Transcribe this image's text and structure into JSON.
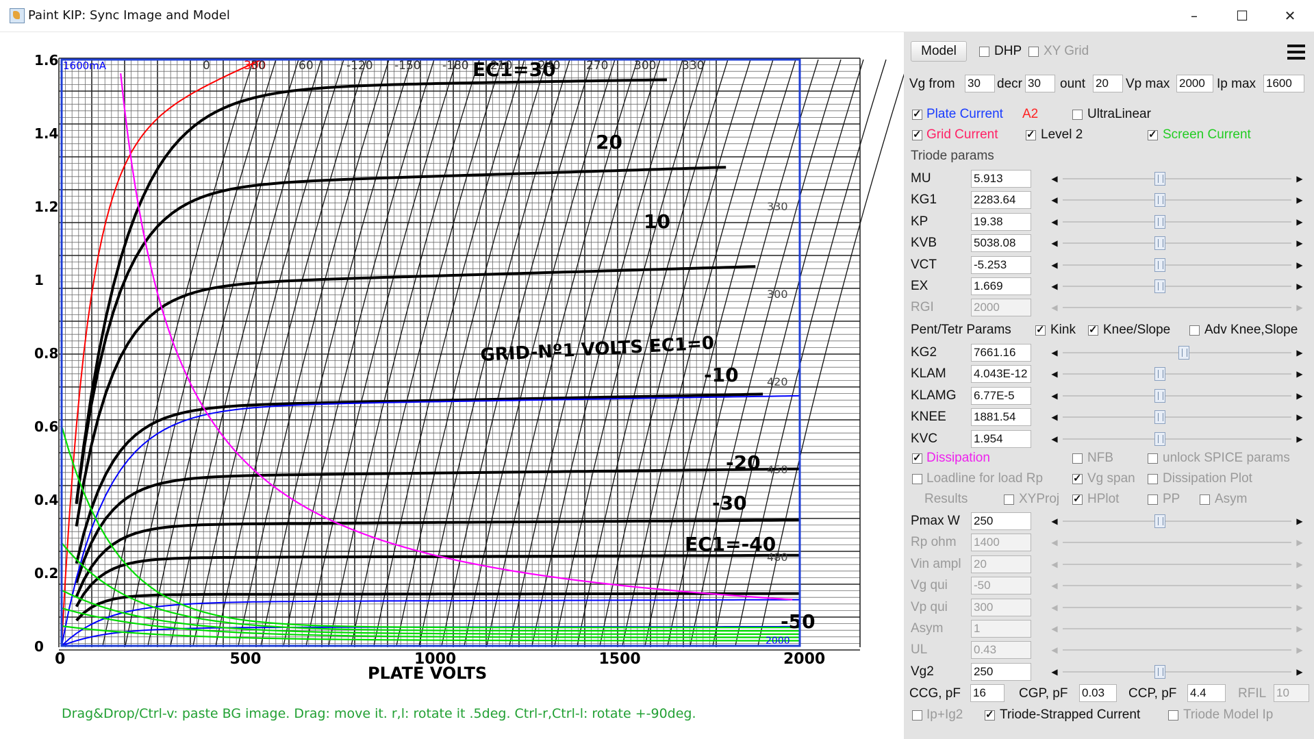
{
  "window": {
    "title": "Paint KIP: Sync Image and Model",
    "min": "–",
    "max": "☐",
    "close": "✕"
  },
  "hint": "Drag&Drop/Ctrl-v: paste BG image. Drag: move it. r,l: rotate it .5deg. Ctrl-r,Ctrl-l: rotate +-90deg.",
  "plot": {
    "y_ticks": [
      "0",
      "0.2",
      "0.4",
      "0.6",
      "0.8",
      "1",
      "1.2",
      "1.4",
      "1.6"
    ],
    "x_ticks": [
      "0",
      "500",
      "1000",
      "1500",
      "2000"
    ],
    "xlabel": "PLATE VOLTS",
    "grid_caption": "GRID-Nº1 VOLTS  EC1=0",
    "curve_labels": [
      "EC1=30",
      "20",
      "10",
      "-10",
      "-20",
      "-30",
      "EC1=-40",
      "-50"
    ],
    "top_label": "1600mA",
    "top_red": "300",
    "top_ticks": [
      "0",
      "30",
      "60",
      "-120",
      "-150",
      "-180",
      "210",
      "240",
      "270",
      "300",
      "330"
    ],
    "right_ticks": [
      "330",
      "300",
      "420",
      "450",
      "480"
    ],
    "bottom_right": "2000",
    "colors": {
      "plate": "#0000ff",
      "grid": "#ff0000",
      "screen": "#00dd00",
      "dissipation": "#ff00ff",
      "frame": "#1f3fd6"
    }
  },
  "panel": {
    "model_button": "Model",
    "dhp": {
      "label": "DHP",
      "checked": false
    },
    "xygrid": {
      "label": "XY Grid",
      "checked": false
    },
    "vg_from": {
      "label": "Vg from",
      "value": "30"
    },
    "decr": {
      "label": "decr",
      "value": "30"
    },
    "count": {
      "label": "ount",
      "value": "20"
    },
    "vp_max": {
      "label": "Vp max",
      "value": "2000"
    },
    "ip_max": {
      "label": "Ip max",
      "value": "1600"
    },
    "plate_current": {
      "label": "Plate Current",
      "checked": true,
      "color": "#1a3cff"
    },
    "a2": {
      "label": "A2",
      "color": "#ff2222"
    },
    "ultralinear": {
      "label": "UltraLinear",
      "checked": false
    },
    "grid_current": {
      "label": "Grid Current",
      "checked": true,
      "color": "#ff2266"
    },
    "level2": {
      "label": "Level 2",
      "checked": true
    },
    "screen_current": {
      "label": "Screen Current",
      "checked": true,
      "color": "#22cc22"
    },
    "triode_header": "Triode params",
    "triode": [
      {
        "name": "MU",
        "value": "5.913",
        "pos": 0.42,
        "enabled": true
      },
      {
        "name": "KG1",
        "value": "2283.64",
        "pos": 0.42,
        "enabled": true
      },
      {
        "name": "KP",
        "value": "19.38",
        "pos": 0.42,
        "enabled": true
      },
      {
        "name": "KVB",
        "value": "5038.08",
        "pos": 0.42,
        "enabled": true
      },
      {
        "name": "VCT",
        "value": "-5.253",
        "pos": 0.42,
        "enabled": true
      },
      {
        "name": "EX",
        "value": "1.669",
        "pos": 0.42,
        "enabled": true
      },
      {
        "name": "RGI",
        "value": "2000",
        "pos": 0.42,
        "enabled": false
      }
    ],
    "pent_header": "Pent/Tetr Params",
    "kink": {
      "label": "Kink",
      "checked": true
    },
    "kneeslope": {
      "label": "Knee/Slope",
      "checked": true
    },
    "advknee": {
      "label": "Adv Knee,Slope",
      "checked": false
    },
    "pent": [
      {
        "name": "KG2",
        "value": "7661.16",
        "pos": 0.53,
        "enabled": true
      },
      {
        "name": "KLAM",
        "value": "4.043E-12",
        "pos": 0.42,
        "enabled": true
      },
      {
        "name": "KLAMG",
        "value": "6.77E-5",
        "pos": 0.42,
        "enabled": true
      },
      {
        "name": "KNEE",
        "value": "1881.54",
        "pos": 0.42,
        "enabled": true
      },
      {
        "name": "KVC",
        "value": "1.954",
        "pos": 0.42,
        "enabled": true
      }
    ],
    "dissipation": {
      "label": "Dissipation",
      "checked": true,
      "color": "#ee22ee"
    },
    "nfb": {
      "label": "NFB",
      "checked": false
    },
    "unlock": {
      "label": "unlock SPICE params",
      "checked": false
    },
    "loadline": {
      "label": "Loadline for load Rp",
      "checked": false
    },
    "vgspan": {
      "label": "Vg span",
      "checked": true
    },
    "dissplot": {
      "label": "Dissipation Plot",
      "checked": false
    },
    "results": "Results",
    "xyproj": {
      "label": "XYProj",
      "checked": false
    },
    "hplot": {
      "label": "HPlot",
      "checked": true
    },
    "pp": {
      "label": "PP",
      "checked": false
    },
    "asym_cb": {
      "label": "Asym",
      "checked": false
    },
    "ops": [
      {
        "name": "Pmax W",
        "value": "250",
        "pos": 0.42,
        "enabled": true
      },
      {
        "name": "Rp ohm",
        "value": "1400",
        "pos": 0.42,
        "enabled": false
      },
      {
        "name": "Vin ampl",
        "value": "20",
        "pos": 0.42,
        "enabled": false
      },
      {
        "name": "Vg qui",
        "value": "-50",
        "pos": 0.42,
        "enabled": false
      },
      {
        "name": "Vp qui",
        "value": "300",
        "pos": 0.42,
        "enabled": false
      },
      {
        "name": "Asym",
        "value": "1",
        "pos": 0.42,
        "enabled": false
      },
      {
        "name": "UL",
        "value": "0.43",
        "pos": 0.42,
        "enabled": false
      },
      {
        "name": "Vg2",
        "value": "250",
        "pos": 0.42,
        "enabled": true
      }
    ],
    "ccg": {
      "label": "CCG, pF",
      "value": "16"
    },
    "cgp": {
      "label": "CGP, pF",
      "value": "0.03"
    },
    "ccp": {
      "label": "CCP, pF",
      "value": "4.4"
    },
    "rfil": {
      "label": "RFIL",
      "value": "10"
    },
    "ipig2": {
      "label": "Ip+Ig2",
      "checked": false
    },
    "triode_strapped": {
      "label": "Triode-Strapped Current",
      "checked": true
    },
    "triode_model": {
      "label": "Triode Model Ip",
      "checked": false
    }
  }
}
